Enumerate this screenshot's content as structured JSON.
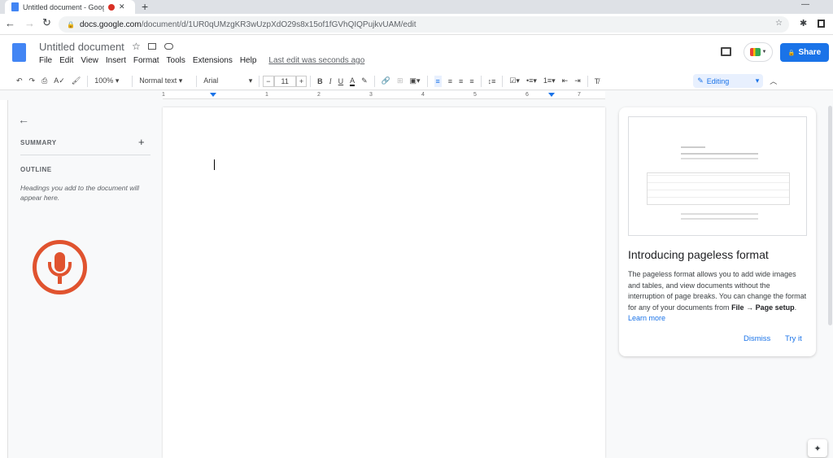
{
  "browser": {
    "tab_title": "Untitled document - Google",
    "url_domain": "docs.google.com",
    "url_path": "/document/d/1UR0qUMzgKR3wUzpXdO29s8x15of1fGVhQIQPujkvUAM/edit"
  },
  "doc": {
    "title": "Untitled document",
    "menu": [
      "File",
      "Edit",
      "View",
      "Insert",
      "Format",
      "Tools",
      "Extensions",
      "Help"
    ],
    "last_edit": "Last edit was seconds ago",
    "share_label": "Share",
    "accent": "#1a73e8"
  },
  "toolbar": {
    "zoom": "100%",
    "style": "Normal text",
    "font": "Arial",
    "font_size": "11",
    "mode": "Editing",
    "minus": "−",
    "plus": "+",
    "bold": "B",
    "italic": "I",
    "underline": "U",
    "color": "A"
  },
  "ruler": {
    "ticks": [
      "1",
      "1",
      "2",
      "3",
      "4",
      "5",
      "6",
      "7"
    ]
  },
  "outline": {
    "summary": "SUMMARY",
    "outline": "OUTLINE",
    "hint": "Headings you add to the document will appear here."
  },
  "card": {
    "title": "Introducing pageless format",
    "body": "The pageless format allows you to add wide images and tables, and view documents without the interruption of page breaks. You can change the format for any of your documents from ",
    "bold1": "File → Page setup",
    "period": ". ",
    "learn": "Learn more",
    "dismiss": "Dismiss",
    "try": "Try it"
  }
}
